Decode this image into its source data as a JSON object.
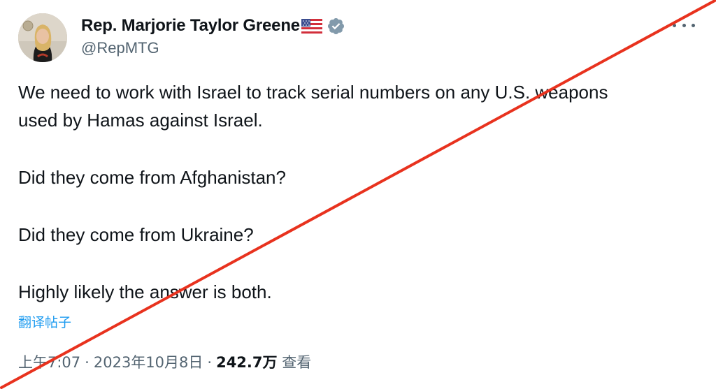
{
  "author": {
    "name": "Rep. Marjorie Taylor Greene",
    "handle": "@RepMTG",
    "flag_icon": "us-flag-icon",
    "verified_icon": "verified-badge-icon",
    "verified_color": "#829aab"
  },
  "tweet": {
    "lines": [
      "We need to work with Israel to track serial numbers on any U.S. weapons",
      "used by Hamas against Israel.",
      "Did they come from Afghanistan?",
      "Did they come from Ukraine?",
      "Highly likely the answer is both."
    ],
    "translate_label": "翻译帖子"
  },
  "meta": {
    "time": "上午7:07",
    "separator": "·",
    "date": "2023年10月8日",
    "views_count": "242.7万",
    "views_label": "查看"
  },
  "overlay": {
    "strike_color": "#e8321e"
  }
}
